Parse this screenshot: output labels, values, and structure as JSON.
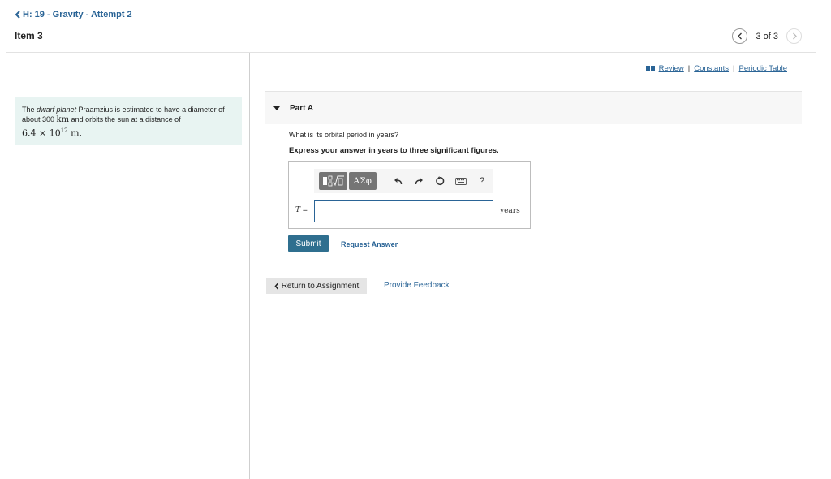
{
  "header": {
    "back_link": "H: 19 - Gravity - Attempt 2",
    "item_title": "Item 3",
    "pager_count": "3 of 3"
  },
  "problem": {
    "text_prefix": "The ",
    "text_italic": "dwarf planet",
    "text_mid": " Praamzius is estimated to have a diameter of about 300 ",
    "unit_km": "km",
    "text_suffix": " and orbits the sun at a distance of",
    "distance_mantissa": "6.4 × 10",
    "distance_exponent": "12",
    "distance_unit": " m."
  },
  "resources": {
    "review": "Review",
    "separator": "|",
    "constants": "Constants",
    "periodic_table": "Periodic Table"
  },
  "part": {
    "label": "Part A",
    "question": "What is its orbital period in years?",
    "instruction": "Express your answer in years to three significant figures."
  },
  "answer": {
    "variable": "T",
    "equals": " =",
    "value": "",
    "unit": "years",
    "toolbar": {
      "greek_label": "ΑΣφ",
      "help_label": "?"
    }
  },
  "actions": {
    "submit": "Submit",
    "request_answer": "Request Answer",
    "return_label": "Return to Assignment",
    "feedback": "Provide Feedback"
  },
  "colors": {
    "link": "#2a6496",
    "submit_bg": "#2f6f8f",
    "problem_bg": "#e8f4f2"
  }
}
